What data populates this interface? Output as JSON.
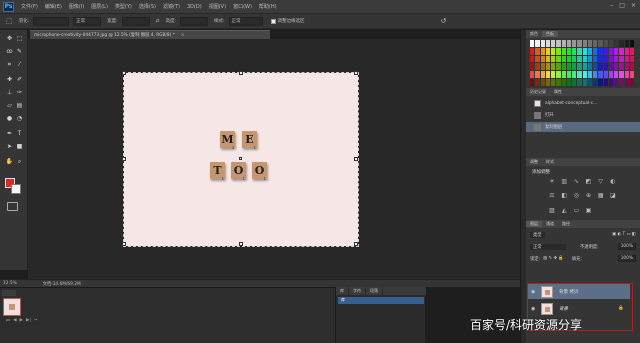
{
  "app": {
    "logo": "Ps"
  },
  "menubar": {
    "items": [
      "文件(F)",
      "编辑(E)",
      "图像(I)",
      "图层(L)",
      "类型(Y)",
      "选择(S)",
      "滤镜(T)",
      "3D(D)",
      "视图(V)",
      "窗口(W)",
      "帮助(H)"
    ],
    "window_controls": [
      "–",
      "□",
      "×"
    ]
  },
  "options_bar": {
    "feather_label": "羽化:",
    "mode_value": "正常",
    "width_label": "宽度:",
    "height_label": "高度:",
    "style_label": "样式:",
    "style_value": "正常",
    "checkbox_label": "调整边缘选区"
  },
  "document": {
    "tab_title": "microphone-creativity-044773.jpg @ 12.5% (复制 图层 4, RGB/8) *",
    "tab_close": "×",
    "tiles_row1": [
      {
        "letter": "M",
        "points": "3"
      },
      {
        "letter": "E",
        "points": "1"
      }
    ],
    "tiles_row2": [
      {
        "letter": "T",
        "points": "1"
      },
      {
        "letter": "O",
        "points": "1"
      },
      {
        "letter": "O",
        "points": "1"
      }
    ]
  },
  "status": {
    "zoom": "12.5%",
    "doc_size": "文档:34.6M/69.2M"
  },
  "timeline": {
    "controls": [
      "⏮",
      "◀",
      "▶",
      "▶|",
      "✂"
    ]
  },
  "channels_panel": {
    "tabs": [
      "库",
      "字符",
      "段落"
    ],
    "row_label": "库"
  },
  "swatch_panel": {
    "tabs": [
      "颜色",
      "色板"
    ]
  },
  "history_panel": {
    "tabs": [
      "历史记录",
      "属性"
    ],
    "items": [
      "alphabet-conceptual-c...",
      "打开",
      "复制图层"
    ]
  },
  "adjust_panel": {
    "tabs": [
      "调整",
      "样式"
    ],
    "title": "添加调整"
  },
  "layers_panel": {
    "tabs": [
      "图层",
      "通道",
      "路径"
    ],
    "filter_label": "类型",
    "mode_label": "正常",
    "opacity_label": "不透明度:",
    "opacity_value": "100%",
    "lock_label": "锁定:",
    "fill_label": "填充:",
    "fill_value": "100%",
    "layers": [
      {
        "name": "背景 拷贝",
        "selected": true
      },
      {
        "name": "背景",
        "selected": false
      }
    ]
  },
  "tool_icons": [
    "move-icon",
    "marquee-icon",
    "lasso-icon",
    "quick-select-icon",
    "crop-icon",
    "eyedropper-icon",
    "healing-icon",
    "brush-icon",
    "stamp-icon",
    "history-brush-icon",
    "eraser-icon",
    "gradient-icon",
    "blur-icon",
    "dodge-icon",
    "pen-icon",
    "type-icon",
    "path-select-icon",
    "shape-icon",
    "hand-icon",
    "zoom-icon"
  ],
  "colors": {
    "foreground": "#d42a2a",
    "background": "#f5f5f5",
    "canvas": "#f6e6e5",
    "tile": "#c49770",
    "layer_selected": "#37608f"
  },
  "watermark": "百家号/科研资源分享"
}
